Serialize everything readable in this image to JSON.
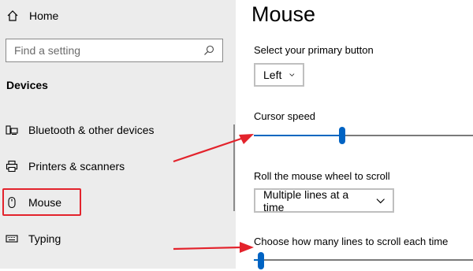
{
  "sidebar": {
    "home_label": "Home",
    "search_placeholder": "Find a setting",
    "section_title": "Devices",
    "items": [
      {
        "label": "Bluetooth & other devices",
        "icon": "bluetooth-devices-icon"
      },
      {
        "label": "Printers & scanners",
        "icon": "printer-icon"
      },
      {
        "label": "Mouse",
        "icon": "mouse-icon"
      },
      {
        "label": "Typing",
        "icon": "keyboard-icon"
      }
    ],
    "selected_item": "Mouse"
  },
  "main": {
    "title": "Mouse",
    "primary_button": {
      "label": "Select your primary button",
      "value": "Left"
    },
    "cursor_speed": {
      "label": "Cursor speed",
      "level": 0.4
    },
    "scroll": {
      "label": "Roll the mouse wheel to scroll",
      "value": "Multiple lines at a time"
    },
    "lines": {
      "label": "Choose how many lines to scroll each time",
      "level": 0.02
    }
  },
  "colors": {
    "accent": "#0067c0",
    "highlight": "#e3232c",
    "sidebar_bg": "#ececec"
  }
}
